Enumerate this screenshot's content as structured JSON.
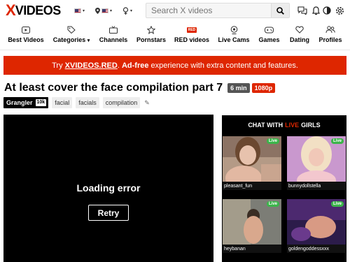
{
  "header": {
    "logo_x": "X",
    "logo_rest": "VIDEOS",
    "search_placeholder": "Search X videos",
    "language_icon": "flag-us-icon",
    "location_icon": "location-pin-icon",
    "gender_icon": "gender-icon"
  },
  "nav": [
    {
      "label": "Best Videos",
      "icon": "play-icon"
    },
    {
      "label": "Categories",
      "icon": "tag-icon",
      "caret": "▾"
    },
    {
      "label": "Channels",
      "icon": "channel-icon"
    },
    {
      "label": "Pornstars",
      "icon": "star-icon"
    },
    {
      "label": "RED videos",
      "icon": "red-badge",
      "badge": "RED"
    },
    {
      "label": "Live Cams",
      "icon": "webcam-icon"
    },
    {
      "label": "Games",
      "icon": "gamepad-icon"
    },
    {
      "label": "Dating",
      "icon": "dating-icon"
    },
    {
      "label": "Profiles",
      "icon": "profiles-icon"
    }
  ],
  "promo": {
    "prefix": "Try ",
    "link": "XVIDEOS.RED",
    "middle": ". ",
    "bold": "Ad-free",
    "suffix": " experience with extra content and features."
  },
  "video": {
    "title": "At least cover the face compilation part 7",
    "duration": "6 min",
    "quality": "1080p",
    "uploader": "Grangler",
    "uploader_count": "10k",
    "tags": [
      "facial",
      "facials",
      "compilation"
    ],
    "error_text": "Loading error",
    "retry_label": "Retry"
  },
  "live_cams": {
    "header_prefix": "CHAT WITH",
    "header_live": "LIVE",
    "header_suffix": "GIRLS",
    "badge": "Live",
    "cams": [
      {
        "name": "pleasant_fun"
      },
      {
        "name": "bunnydollstella"
      },
      {
        "name": "heybanan"
      },
      {
        "name": "goldengoddessxxx"
      }
    ]
  },
  "colors": {
    "brand_red": "#de2600",
    "live_green": "#3bb54a"
  }
}
